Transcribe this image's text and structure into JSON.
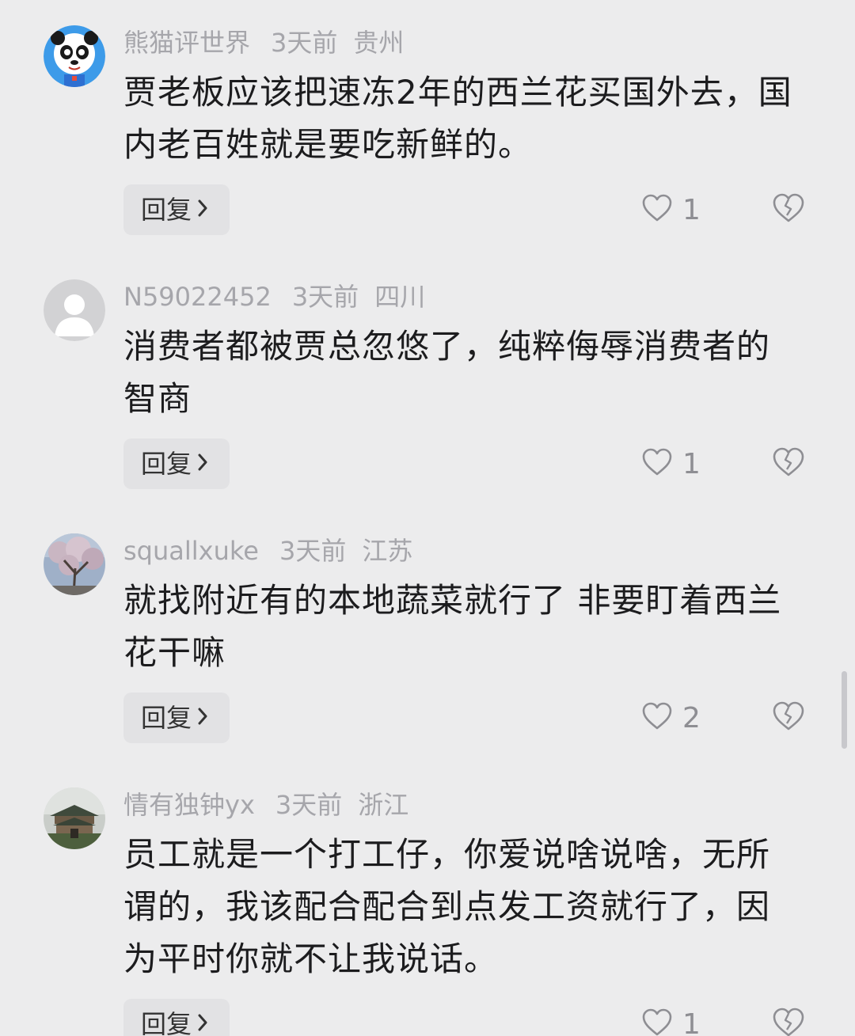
{
  "comments": [
    {
      "user": "熊猫评世界",
      "time": "3天前",
      "location": "贵州",
      "lines": [
        "贾老板应该把速冻2年的西兰花买国外去，国",
        "内老百姓就是要吃新鲜的。"
      ],
      "reply_label": "回复",
      "likes": "1",
      "avatar": "panda-avatar"
    },
    {
      "user": "N59022452",
      "time": "3天前",
      "location": "四川",
      "lines": [
        "消费者都被贾总忽悠了，纯粹侮辱消费者的",
        "智商"
      ],
      "reply_label": "回复",
      "likes": "1",
      "avatar": "default-avatar"
    },
    {
      "user": "squallxuke",
      "time": "3天前",
      "location": "江苏",
      "lines": [
        "就找附近有的本地蔬菜就行了 非要盯着西兰",
        "花干嘛"
      ],
      "reply_label": "回复",
      "likes": "2",
      "avatar": "tree-photo-avatar"
    },
    {
      "user": "情有独钟yx",
      "time": "3天前",
      "location": "浙江",
      "lines": [
        "员工就是一个打工仔，你爱说啥说啥，无所",
        "谓的，我该配合配合到点发工资就行了，因",
        "为平时你就不让我说话。"
      ],
      "reply_label": "回复",
      "likes": "1",
      "avatar": "building-photo-avatar"
    }
  ],
  "colors": {
    "background": "#ececed",
    "meta_text": "#a6a6ab",
    "body_text": "#1c1c1e",
    "reply_bg": "#e2e2e4"
  },
  "icons": [
    "heart-outline-icon",
    "broken-heart-icon",
    "chevron-right-icon"
  ]
}
